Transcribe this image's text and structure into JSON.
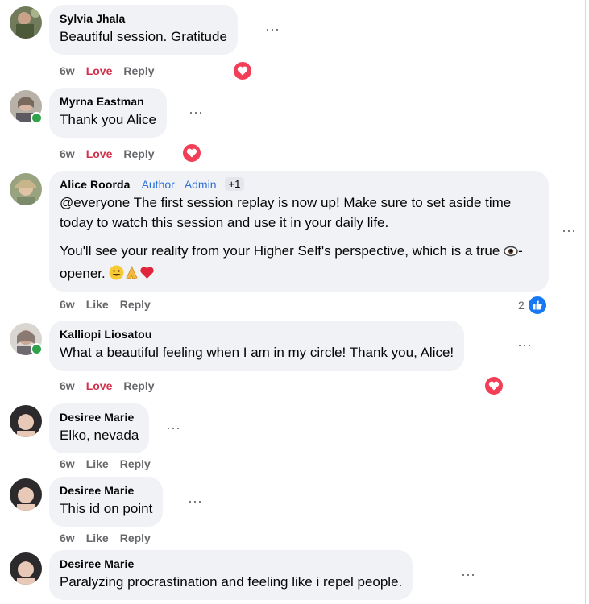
{
  "comments": [
    {
      "author": "Sylvia Jhala",
      "text": "Beautiful session. Gratitude",
      "time": "6w",
      "reaction_label": "Love",
      "reply": "Reply"
    },
    {
      "author": "Myrna Eastman",
      "text": "Thank you Alice",
      "time": "6w",
      "reaction_label": "Love",
      "reply": "Reply"
    },
    {
      "author": "Alice Roorda",
      "badges": [
        "Author",
        "Admin"
      ],
      "badge_extra": "+1",
      "text_p1": "@everyone The first session replay is now up! Make sure to set aside time today to watch this session and use it in your daily life.",
      "text_p2_before": "You'll see your reality from your Higher Self's perspective, which is a true ",
      "text_p2_after": "-opener. ",
      "time": "6w",
      "reaction_label": "Like",
      "reply": "Reply",
      "reaction_count": "2"
    },
    {
      "author": "Kalliopi Liosatou",
      "text": "What a beautiful feeling when I am in my circle! Thank you, Alice!",
      "time": "6w",
      "reaction_label": "Love",
      "reply": "Reply"
    },
    {
      "author": "Desiree Marie",
      "text": "Elko, nevada",
      "time": "6w",
      "reaction_label": "Like",
      "reply": "Reply"
    },
    {
      "author": "Desiree Marie",
      "text": "This id on point",
      "time": "6w",
      "reaction_label": "Like",
      "reply": "Reply"
    },
    {
      "author": "Desiree Marie",
      "text": "Paralyzing procrastination and feeling like i repel people."
    }
  ],
  "more_icon": "more-options-icon",
  "colors": {
    "love": "#d3304b",
    "link": "#2e6fd6",
    "bubble": "#f0f2f5",
    "muted": "#65676b",
    "online": "#31a24c",
    "like": "#1877f2",
    "heart": "#f33e58"
  }
}
